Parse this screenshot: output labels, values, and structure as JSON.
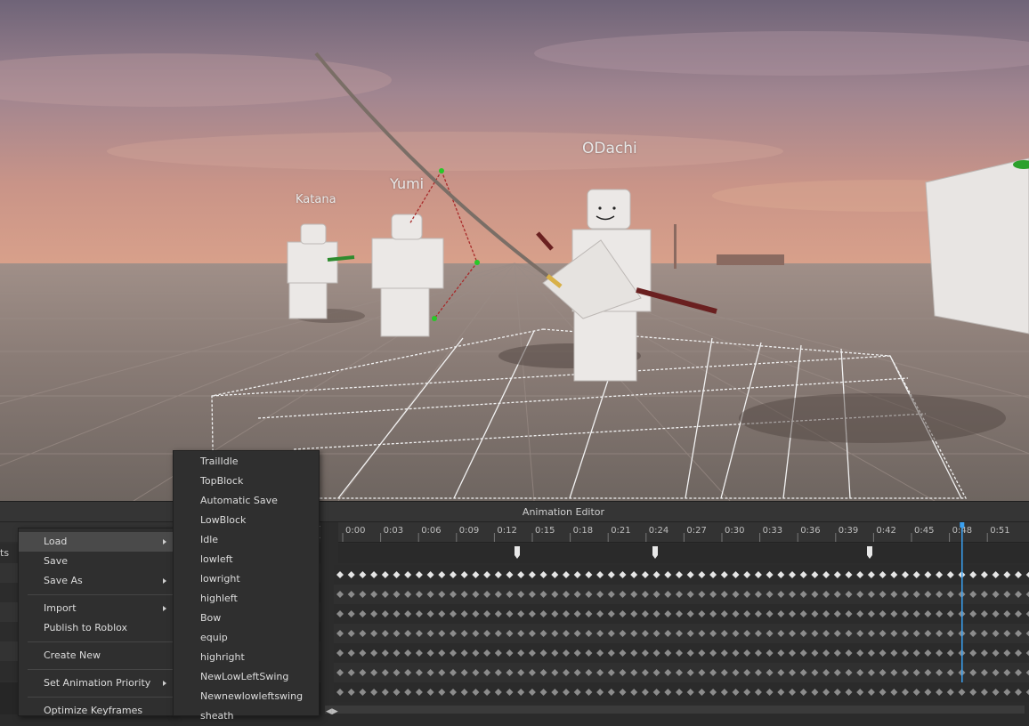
{
  "scene": {
    "characters": [
      {
        "name": "Katana"
      },
      {
        "name": "Yumi"
      },
      {
        "name": "ODachi"
      }
    ]
  },
  "editor": {
    "title": "Animation Editor",
    "left_panel_partial_label": "ts",
    "timeline": {
      "ticks": [
        "0:00",
        "0:03",
        "0:06",
        "0:09",
        "0:12",
        "0:15",
        "0:18",
        "0:21",
        "0:24",
        "0:27",
        "0:30",
        "0:33",
        "0:36",
        "0:39",
        "0:42",
        "0:45",
        "0:48",
        "0:51"
      ],
      "playhead_time": "0:49",
      "track_count": 6,
      "keyframe_columns": 62
    }
  },
  "context_menu": {
    "items": [
      {
        "label": "Load",
        "submenu": true,
        "highlighted": true
      },
      {
        "label": "Save",
        "submenu": false
      },
      {
        "label": "Save As",
        "submenu": true
      },
      {
        "label": "Import",
        "submenu": true
      },
      {
        "label": "Publish to Roblox",
        "submenu": false
      },
      {
        "label": "Create New",
        "submenu": false
      },
      {
        "label": "Set Animation Priority",
        "submenu": true
      },
      {
        "label": "Optimize Keyframes",
        "submenu": false
      }
    ]
  },
  "load_submenu": {
    "items": [
      "TrailIdle",
      "TopBlock",
      "Automatic Save",
      "LowBlock",
      "Idle",
      "lowleft",
      "lowright",
      "highleft",
      "Bow",
      "equip",
      "highright",
      "NewLowLeftSwing",
      "Newnewlowleftswing",
      "sheath"
    ]
  },
  "colors": {
    "accent_playhead": "#3aa0f0",
    "menu_highlight": "#4a4a4a",
    "editor_bg": "#2e2e2e"
  }
}
